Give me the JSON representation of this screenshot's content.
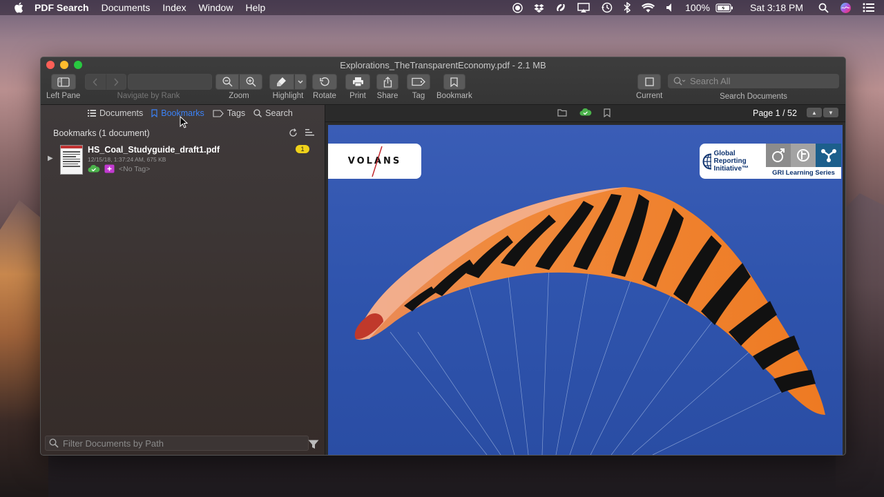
{
  "menubar": {
    "app_name": "PDF Search",
    "menus": [
      "Documents",
      "Index",
      "Window",
      "Help"
    ],
    "battery": "100%",
    "clock": "Sat 3:18 PM"
  },
  "window": {
    "title": "Explorations_TheTransparentEconomy.pdf - 2.1 MB"
  },
  "toolbar": {
    "left_pane": "Left Pane",
    "navigate": "Navigate by Rank",
    "zoom": "Zoom",
    "highlight": "Highlight",
    "rotate": "Rotate",
    "print": "Print",
    "share": "Share",
    "tag": "Tag",
    "bookmark": "Bookmark",
    "current": "Current",
    "search_placeholder": "Search All",
    "search_label": "Search Documents"
  },
  "sidebar": {
    "tabs": [
      "Documents",
      "Bookmarks",
      "Tags",
      "Search"
    ],
    "active_tab": "Bookmarks",
    "header": "Bookmarks (1 document)",
    "documents": [
      {
        "name": "HS_Coal_Studyguide_draft1.pdf",
        "meta": "12/15/18, 1:37:24 AM, 675 KB",
        "tag": "<No Tag>",
        "count": "1"
      }
    ],
    "filter_placeholder": "Filter Documents by Path"
  },
  "viewer": {
    "page_info": "Page 1 / 52",
    "volans_logo": "VOLANS",
    "gri_text": "Global Reporting Initiative™",
    "gri_series": "GRI Learning Series"
  },
  "colors": {
    "accent": "#3b82f6",
    "badge": "#f0d21a",
    "pdf_sky": "#2f54ad"
  }
}
